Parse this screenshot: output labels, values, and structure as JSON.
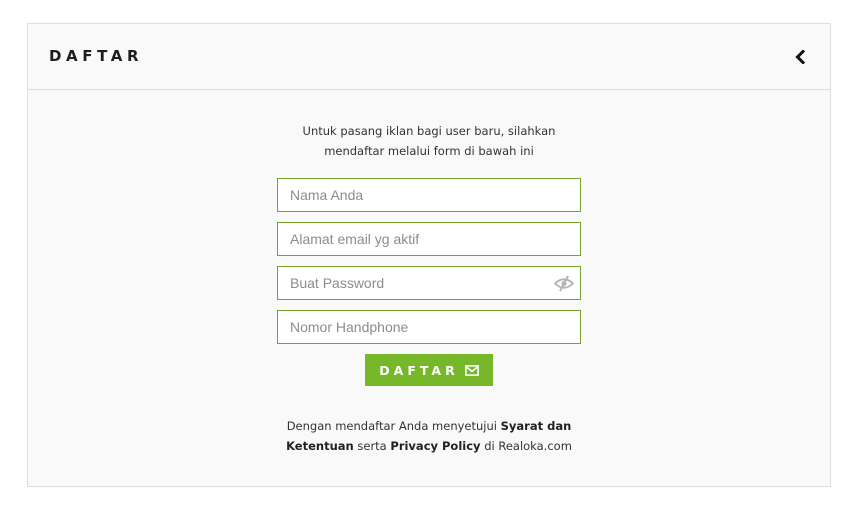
{
  "header": {
    "title": "DAFTAR",
    "back_icon": "chevron-left-icon"
  },
  "intro": {
    "line1": "Untuk pasang iklan bagi user baru, silahkan",
    "line2": "mendaftar melalui form di bawah ini"
  },
  "form": {
    "name": {
      "value": "",
      "placeholder": "Nama Anda"
    },
    "email": {
      "value": "",
      "placeholder": "Alamat email yg aktif"
    },
    "password": {
      "value": "",
      "placeholder": "Buat Password",
      "toggle_icon": "eye-slash-icon"
    },
    "phone": {
      "value": "",
      "placeholder": "Nomor Handphone"
    },
    "submit_label": "DAFTAR",
    "submit_icon": "envelope-icon"
  },
  "terms": {
    "prefix": "Dengan mendaftar Anda menyetujui",
    "terms_link_1": "Syarat dan",
    "terms_link_2": "Ketentuan",
    "middle": "serta",
    "privacy_link": "Privacy Policy",
    "suffix": "di Realoka.com"
  },
  "colors": {
    "accent": "#76b82a",
    "field_border": "#76a12a",
    "panel_bg": "#f9f9f9",
    "panel_border": "#dedede"
  }
}
